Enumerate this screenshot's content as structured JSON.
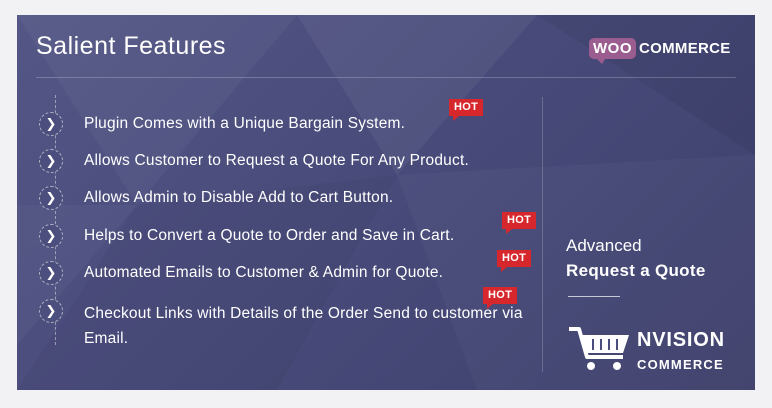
{
  "header": {
    "title": "Salient Features",
    "woo_logo_left": "WOO",
    "woo_logo_right": "COMMERCE"
  },
  "features": [
    {
      "text": "Plugin Comes with a Unique Bargain System.",
      "hot": true,
      "hot_label": "HOT"
    },
    {
      "text": "Allows Customer to Request a Quote For Any Product.",
      "hot": false
    },
    {
      "text": "Allows Admin to Disable Add to Cart Button.",
      "hot": false
    },
    {
      "text": "Helps to Convert a Quote to Order and Save in Cart.",
      "hot": true,
      "hot_label": "HOT"
    },
    {
      "text": "Automated Emails to Customer & Admin for Quote.",
      "hot": true,
      "hot_label": "HOT"
    },
    {
      "text": "Checkout Links with Details of the Order Send to customer via Email.",
      "hot": true,
      "hot_label": "HOT"
    }
  ],
  "product": {
    "subtitle": "Advanced",
    "name": "Request a Quote"
  },
  "brand": {
    "name": "NVISION",
    "tagline": "COMMERCE",
    "icon": "shopping-cart-icon"
  },
  "colors": {
    "background": "#4d4f7f",
    "hot_badge": "#d6282c",
    "woo_purple": "#9b5c8f"
  }
}
